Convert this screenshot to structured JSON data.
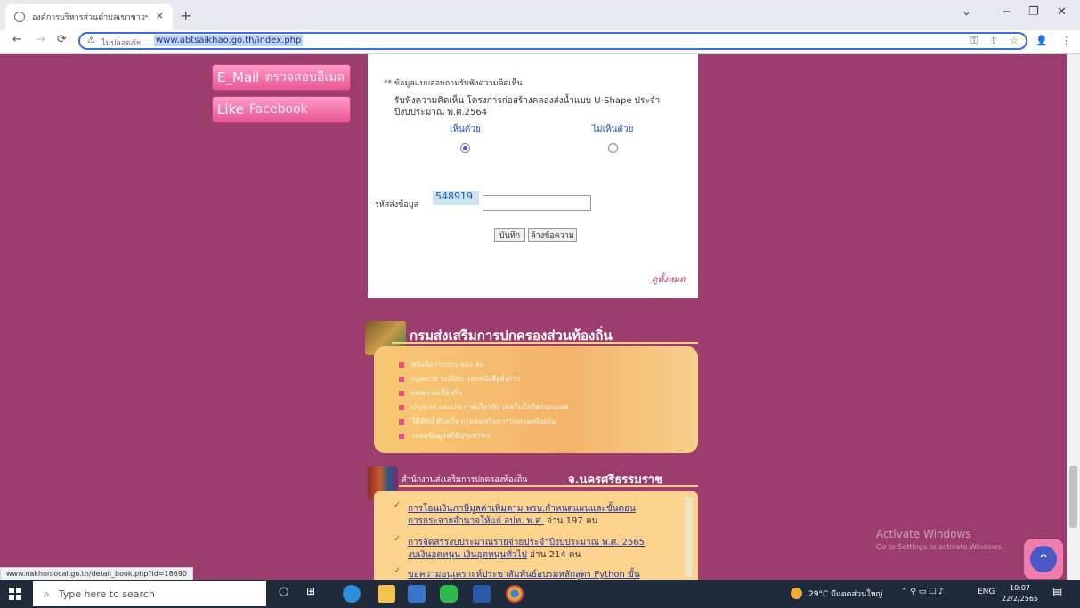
{
  "browser": {
    "tab_title": "องค์การบริหารส่วนตำบลเขาขาวฯ ตำบ",
    "tab_close": "×",
    "new_tab": "+",
    "not_secure": "ไม่ปลอดภัย",
    "url": "www.abtsaikhao.go.th/index.php",
    "status_url": "www.nakhonlocal.go.th/detail_book.php?id=18690",
    "window_controls": [
      "⌄",
      "−",
      "❐",
      "✕"
    ]
  },
  "sidebar": {
    "email_key": "E_Mail",
    "email_label": "ตรวจสอบอีเมล",
    "like_key": "Like",
    "like_label": "Facebook"
  },
  "poll": {
    "header": "** ข้อมูลแบบสอบถามรับฟังความคิดเห็น",
    "question_line1": "รับฟังความคิดเห็น โครงการก่อสร้างคลองส่งน้ำแบบ U-Shape ประจำ",
    "question_line2": "ปีงบประมาณ พ.ศ.2564",
    "option_agree": "เห็นด้วย",
    "option_disagree": "ไม่เห็นด้วย",
    "code_label": "รหัสส่งข้อมูล",
    "code_value": "548919",
    "save_button": "บันทึก",
    "clear_button": "ล้างข้อความ",
    "view_all": "ดูทั้งหมด"
  },
  "dla_section": {
    "title": "กรมส่งเสริมการปกครองส่วนท้องถิ่น",
    "items": [
      "หนังสือราชการ ของ สถ",
      "กฎหมาย ระเบียบ และหนังสือสั่งการ",
      "บทความเกี่ยวกับ",
      "ประกาศ และประกาศเกี่ยวกับ เทคโนโลยีสารสนเทศ",
      "วีดีทัศน์ พันธกิจ กรมส่งเสริมการปกครองท้องถิ่น",
      "ระบบข้อมูลสถิติประชาชน"
    ]
  },
  "provincial_section": {
    "title_prefix": "สำนักงานส่งเสริมการปกครองท้องถิ่น",
    "title_province": "จ.นครศรีธรรมราช",
    "rows": [
      {
        "line1": "การโอนเงินภาษีมูลค่าเพิ่มตาม พรบ.กำหนดแผนและขั้นตอน",
        "line2": "การกระจายอำนาจให้แก่ อปท. พ.ศ.",
        "count": "อ่าน 197 คน"
      },
      {
        "line1": "การจัดสรรงบประมาณรายจ่ายประจำปีงบประมาณ พ.ศ. 2565",
        "line2": "งบเงินอุดหนุน เงินอุดหนุนทั่วไป",
        "count": "อ่าน 214 คน"
      },
      {
        "line1": "ขอความอนุเคราะห์ประชาสัมพันธ์อบรมหลักสูตร Python ขั้น",
        "line2": "",
        "count": ""
      }
    ]
  },
  "watermark": {
    "line1": "Activate Windows",
    "line2": "Go to Settings to activate Windows."
  },
  "taskbar": {
    "search_placeholder": "Type here to search",
    "weather": "29°C มีแดดส่วนใหญ่",
    "lang": "ENG",
    "time": "10:07",
    "date": "22/2/2565"
  }
}
